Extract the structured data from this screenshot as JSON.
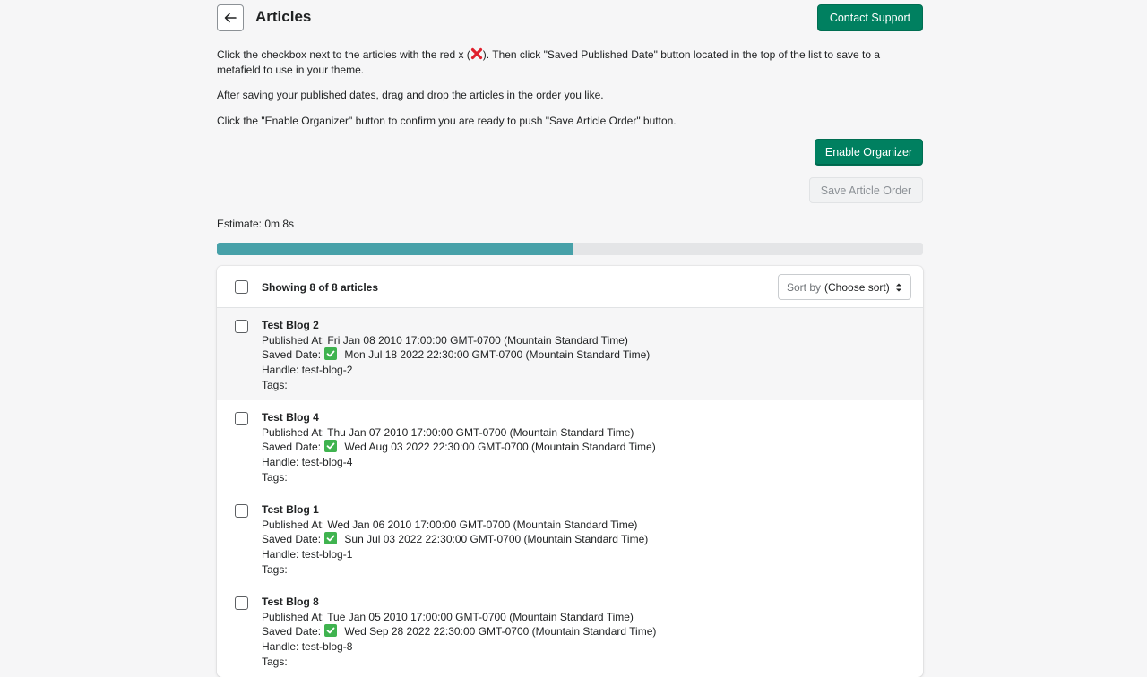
{
  "header": {
    "title": "Articles",
    "contact_label": "Contact Support"
  },
  "instructions": {
    "p1_before": "Click the checkbox next to the articles with the red x (",
    "p1_after": "). Then click \"Saved Published Date\" button located in the top of the list to save to a metafield to use in your theme.",
    "p2": "After saving your published dates, drag and drop the articles in the order you like.",
    "p3": "Click the \"Enable Organizer\" button to confirm you are ready to push \"Save Article Order\" button."
  },
  "actions": {
    "enable_label": "Enable Organizer",
    "save_order_label": "Save Article Order"
  },
  "estimate": "Estimate: 0m 8s",
  "progress": {
    "percent": 50.4
  },
  "list": {
    "showing": "Showing 8 of 8 articles",
    "sort_label": "Sort by",
    "sort_value": "(Choose sort)",
    "articles": [
      {
        "title": "Test Blog 2",
        "published": "Published At: Fri Jan 08 2010 17:00:00 GMT-0700 (Mountain Standard Time)",
        "saved_label": "Saved Date:",
        "saved_value": "Mon Jul 18 2022 22:30:00 GMT-0700 (Mountain Standard Time)",
        "handle": "Handle: test-blog-2",
        "tags": "Tags:"
      },
      {
        "title": "Test Blog 4",
        "published": "Published At: Thu Jan 07 2010 17:00:00 GMT-0700 (Mountain Standard Time)",
        "saved_label": "Saved Date:",
        "saved_value": "Wed Aug 03 2022 22:30:00 GMT-0700 (Mountain Standard Time)",
        "handle": "Handle: test-blog-4",
        "tags": "Tags:"
      },
      {
        "title": "Test Blog 1",
        "published": "Published At: Wed Jan 06 2010 17:00:00 GMT-0700 (Mountain Standard Time)",
        "saved_label": "Saved Date:",
        "saved_value": "Sun Jul 03 2022 22:30:00 GMT-0700 (Mountain Standard Time)",
        "handle": "Handle: test-blog-1",
        "tags": "Tags:"
      },
      {
        "title": "Test Blog 8",
        "published": "Published At: Tue Jan 05 2010 17:00:00 GMT-0700 (Mountain Standard Time)",
        "saved_label": "Saved Date:",
        "saved_value": "Wed Sep 28 2022 22:30:00 GMT-0700 (Mountain Standard Time)",
        "handle": "Handle: test-blog-8",
        "tags": "Tags:"
      }
    ]
  },
  "colors": {
    "primary": "#008060",
    "progress": "#47a1a9",
    "check": "#3fb34f",
    "red_x": "#e0212e"
  }
}
